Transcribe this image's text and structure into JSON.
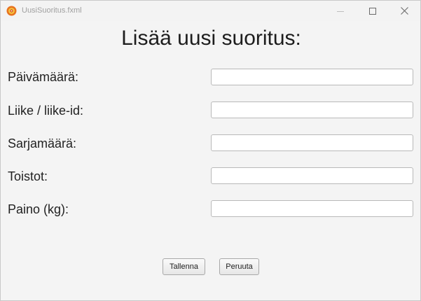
{
  "window": {
    "title": "UusiSuoritus.fxml",
    "controls": [
      "minimize-icon",
      "maximize-icon",
      "close-icon"
    ],
    "app_icon": "app-icon"
  },
  "form": {
    "heading": "Lisää uusi suoritus:",
    "fields": [
      {
        "label": "Päivämäärä:",
        "value": ""
      },
      {
        "label": "Liike / liike-id:",
        "value": ""
      },
      {
        "label": "Sarjamäärä:",
        "value": ""
      },
      {
        "label": "Toistot:",
        "value": ""
      },
      {
        "label": "Paino (kg):",
        "value": ""
      }
    ]
  },
  "buttons": {
    "save": "Tallenna",
    "cancel": "Peruuta"
  },
  "colors": {
    "app_icon_outer": "#e8731e",
    "app_icon_inner": "#f5c542",
    "background": "#f4f4f4"
  }
}
